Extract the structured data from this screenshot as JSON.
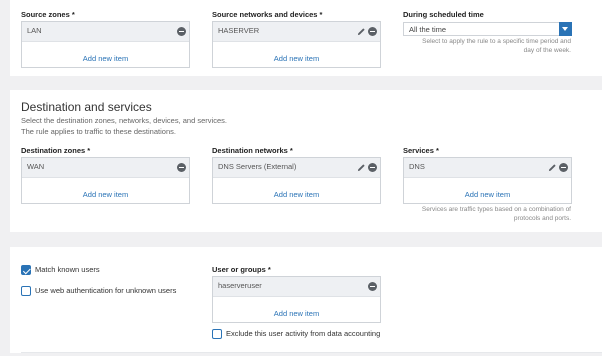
{
  "source": {
    "zones": {
      "label": "Source zones *",
      "item": "LAN",
      "add": "Add new item"
    },
    "networks": {
      "label": "Source networks and devices *",
      "item": "HASERVER",
      "add": "Add new item"
    },
    "schedule": {
      "label": "During scheduled time",
      "value": "All the time",
      "hint_line1": "Select to apply the rule to a specific time period and",
      "hint_line2": "day of the week."
    }
  },
  "destination": {
    "title": "Destination and services",
    "subtitle1": "Select the destination zones, networks, devices, and services.",
    "subtitle2": "The rule applies to traffic to these destinations.",
    "zones": {
      "label": "Destination zones *",
      "item": "WAN",
      "add": "Add new item"
    },
    "networks": {
      "label": "Destination networks *",
      "item": "DNS Servers (External)",
      "add": "Add new item"
    },
    "services": {
      "label": "Services *",
      "item": "DNS",
      "add": "Add new item",
      "hint_line1": "Services are traffic types based on a combination of",
      "hint_line2": "protocols and ports."
    }
  },
  "identity": {
    "match_known_users": {
      "label": "Match known users",
      "checked": true
    },
    "web_auth": {
      "label": "Use web authentication for unknown users",
      "checked": false
    },
    "users": {
      "label": "User or groups *",
      "item": "haserveruser",
      "add": "Add new item"
    },
    "exclude_accounting": {
      "label": "Exclude this user activity from data accounting",
      "checked": false
    }
  },
  "colors": {
    "accent": "#2a73b6",
    "background": "#f0f0f2",
    "panel": "#ffffff",
    "item_bg": "#eef0f3"
  },
  "icons": {
    "remove": "minus-circle-icon",
    "edit": "pencil-icon",
    "dropdown": "chevron-down-icon"
  }
}
